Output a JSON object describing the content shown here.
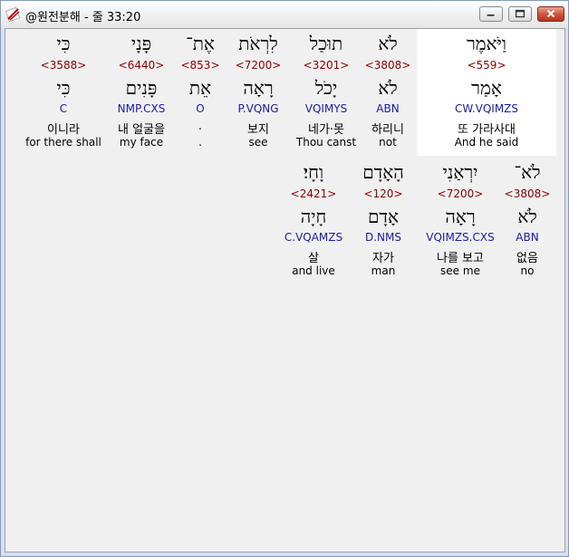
{
  "window": {
    "title": "@원전분해 - 줄 33:20",
    "controls": [
      "minimize-icon",
      "maximize-icon",
      "close-icon"
    ]
  },
  "colors": {
    "strong": "#8b0000",
    "parsing": "#1a1aa6",
    "selected_bg": "#ffffff"
  },
  "line1": [
    {
      "surface": "וַיֹּאמֶר",
      "strong": "<559>",
      "lemma": "אָמַר",
      "parsing": "CW.VQIMZS",
      "korean": "또 가라사대",
      "english": "And he said",
      "selected": true
    },
    {
      "surface": "לֹא",
      "strong": "<3808>",
      "lemma": "לֹא",
      "parsing": "ABN",
      "korean": "하리니",
      "english": "not"
    },
    {
      "surface": "תוּכַל",
      "strong": "<3201>",
      "lemma": "יָכֹל",
      "parsing": "VQIMYS",
      "korean": "네가·못",
      "english": "Thou canst"
    },
    {
      "surface": "לִרְאֹת",
      "strong": "<7200>",
      "lemma": "רָאָה",
      "parsing": "P.VQNG",
      "korean": "보지",
      "english": "see"
    },
    {
      "surface": "אֶת־",
      "strong": "<853>",
      "lemma": "אֵת",
      "parsing": "O",
      "korean": ".",
      "english": "."
    },
    {
      "surface": "פָּנָי",
      "strong": "<6440>",
      "lemma": "פָּנִים",
      "parsing": "NMP.CXS",
      "korean": "내 얼굴을",
      "english": "my face"
    },
    {
      "surface": "כִּי",
      "strong": "<3588>",
      "lemma": "כִּי",
      "parsing": "C",
      "korean": "이니라",
      "english": "for there shall"
    }
  ],
  "line2": [
    {
      "surface": "לֹא־",
      "strong": "<3808>",
      "lemma": "לֹא",
      "parsing": "ABN",
      "korean": "없음",
      "english": "no"
    },
    {
      "surface": "יִרְאַנִי",
      "strong": "<7200>",
      "lemma": "רָאָה",
      "parsing": "VQIMZS.CXS",
      "korean": "나를 보고",
      "english": "see me"
    },
    {
      "surface": "הָאָדָם",
      "strong": "<120>",
      "lemma": "אָדָם",
      "parsing": "D.NMS",
      "korean": "자가",
      "english": "man"
    },
    {
      "surface": "וָחָי׃",
      "strong": "<2421>",
      "lemma": "חָיָה",
      "parsing": "C.VQAMZS",
      "korean": "살",
      "english": "and live"
    }
  ]
}
